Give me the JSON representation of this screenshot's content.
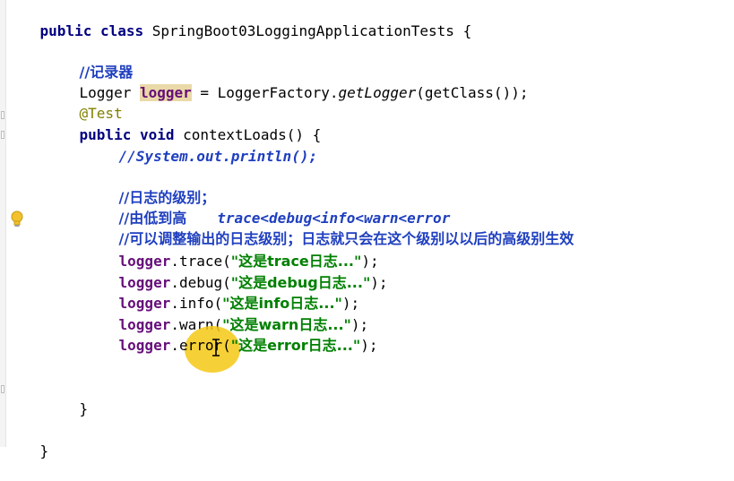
{
  "editor": {
    "class_decl": {
      "kw_public": "public",
      "kw_class": "class",
      "name": "SpringBoot03LoggingApplicationTests {"
    },
    "comment_logger": "//记录器",
    "logger_decl": {
      "type": "Logger ",
      "var": "logger",
      "assign": " = LoggerFactory.",
      "method": "getLogger",
      "args": "(getClass());"
    },
    "annotation": "@Test",
    "method_decl": {
      "kw_public": "public",
      "kw_void": "void",
      "name": "contextLoads() {"
    },
    "comment_sysout": "//System.out.println();",
    "comment_levels": "//日志的级别；",
    "comment_order_prefix": "//由低到高",
    "comment_order_levels": "trace<debug<info<warn<error",
    "comment_adjust": "//可以调整输出的日志级别；日志就只会在这个级别以以后的高级别生效",
    "calls": [
      {
        "obj": "logger",
        "method": ".trace(",
        "str": "\"这是trace日志...\"",
        "end": ");"
      },
      {
        "obj": "logger",
        "method": ".debug(",
        "str": "\"这是debug日志...\"",
        "end": ");"
      },
      {
        "obj": "logger",
        "method": ".info(",
        "str": "\"这是info日志...\"",
        "end": ");"
      },
      {
        "obj": "logger",
        "method": ".warn(",
        "str": "\"这是warn日志...\"",
        "end": ");"
      },
      {
        "obj": "logger",
        "method": ".error(",
        "str": "\"这是error日志...\"",
        "end": ");"
      }
    ],
    "close_method": "}",
    "close_class": "}"
  },
  "icons": {
    "intention": "lightbulb-icon",
    "cursor": "text-cursor-icon"
  },
  "colors": {
    "keyword": "#000080",
    "comment": "#1f3fbf",
    "field": "#660e7a",
    "string": "#008000",
    "annotation": "#808000",
    "highlight": "#ead9a8",
    "cursor_halo": "#f5c814"
  }
}
